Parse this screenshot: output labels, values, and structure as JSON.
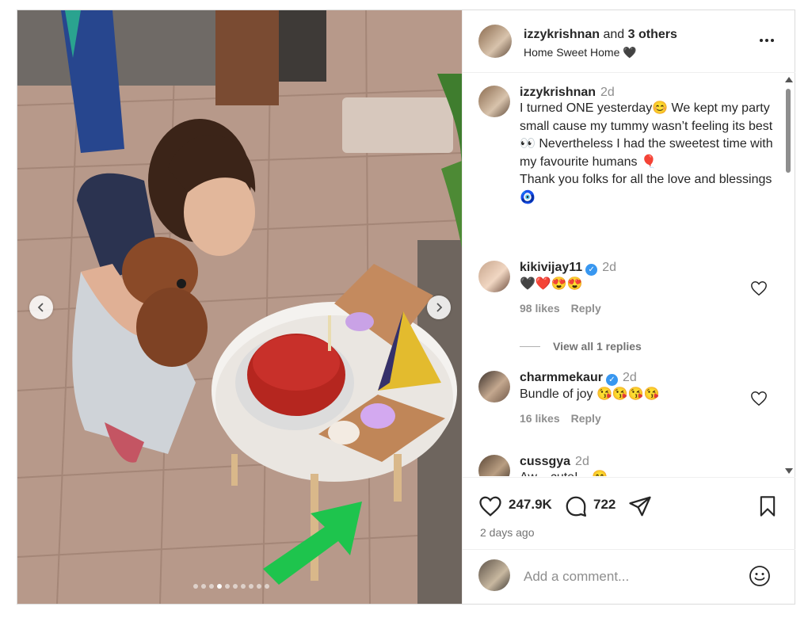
{
  "post_header": {
    "username": "izzykrishnan",
    "and_text": "and",
    "others": "3 others",
    "location": "Home Sweet Home 🖤"
  },
  "caption": {
    "username": "izzykrishnan",
    "time": "2d",
    "text1": "I turned ONE yesterday😊 We kept my party small cause my tummy wasn’t feeling its best👀 Nevertheless I had the sweetest time with my favourite humans 🎈",
    "text2": "Thank you folks for all the love and blessings🧿"
  },
  "comments": [
    {
      "username": "kikivijay11",
      "verified": true,
      "time": "2d",
      "text": "🖤❤️😍😍",
      "likes": "98 likes",
      "reply": "Reply"
    },
    {
      "username": "charmmekaur",
      "verified": true,
      "time": "2d",
      "text": "Bundle of joy 😘😘😘😘",
      "likes": "16 likes",
      "reply": "Reply"
    },
    {
      "username": "cussgya",
      "verified": false,
      "time": "2d",
      "text": "Aw... cute! ...😊"
    }
  ],
  "view_replies": "View all 1 replies",
  "actions": {
    "likes": "247.9K",
    "comments": "722",
    "date": "2 days ago"
  },
  "comment_input": {
    "placeholder": "Add a comment..."
  },
  "carousel": {
    "total_slides": 10,
    "active_index": 3
  },
  "icons": [
    "chevron-left-icon",
    "chevron-right-icon",
    "more-icon",
    "heart-icon",
    "comment-icon",
    "share-icon",
    "bookmark-icon",
    "emoji-icon",
    "verified-icon"
  ]
}
